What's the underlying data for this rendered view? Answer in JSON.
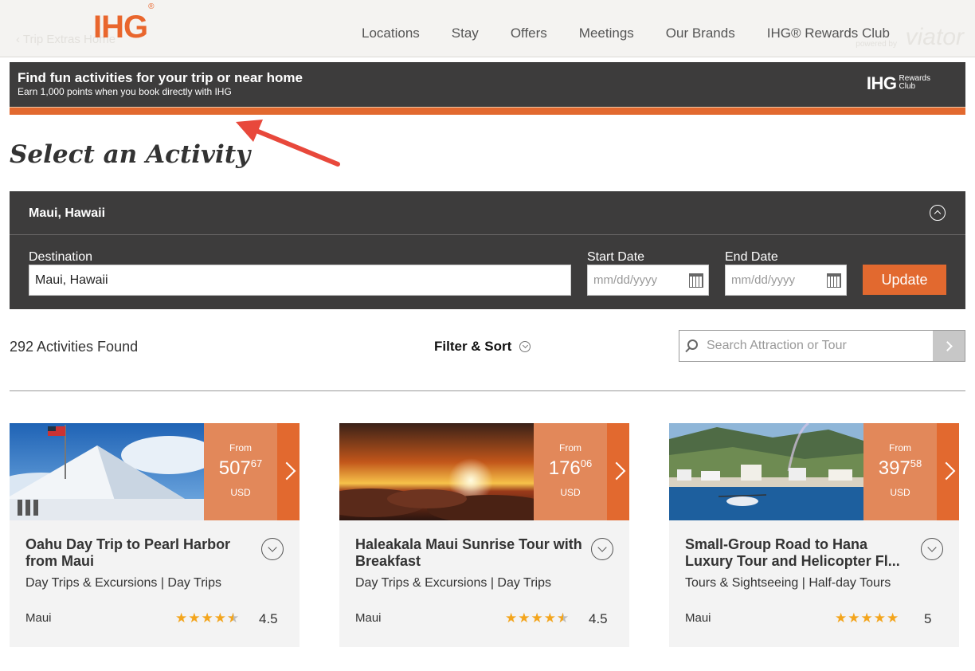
{
  "nav": {
    "logo": "IHG",
    "logo_mark": "®",
    "back_link": "Trip Extras Home",
    "powered_by": "powered by",
    "partner": "viator",
    "links": [
      "Locations",
      "Stay",
      "Offers",
      "Meetings",
      "Our Brands",
      "IHG® Rewards Club"
    ]
  },
  "banner": {
    "title": "Find fun activities for your trip or near home",
    "subtitle": "Earn 1,000 points when you book directly with IHG",
    "logo": "IHG",
    "logo_sub1": "Rewards",
    "logo_sub2": "Club",
    "stripe_color": "#e2692f"
  },
  "page": {
    "title": "Select an Activity"
  },
  "search_panel": {
    "heading": "Maui, Hawaii",
    "destination_label": "Destination",
    "destination_value": "Maui, Hawaii",
    "start_label": "Start Date",
    "start_placeholder": "mm/dd/yyyy",
    "end_label": "End Date",
    "end_placeholder": "mm/dd/yyyy",
    "update_label": "Update"
  },
  "results": {
    "count_text": "292 Activities Found",
    "filter_label": "Filter & Sort",
    "search_placeholder": "Search Attraction or Tour"
  },
  "cards": [
    {
      "from": "From",
      "price_main": "507",
      "price_cents": "67",
      "currency": "USD",
      "title": "Oahu Day Trip to Pearl Harbor from Maui",
      "category": "Day Trips & Excursions | Day Trips",
      "location": "Maui",
      "rating": "4.5"
    },
    {
      "from": "From",
      "price_main": "176",
      "price_cents": "06",
      "currency": "USD",
      "title": "Haleakala Maui Sunrise Tour with Breakfast",
      "category": "Day Trips & Excursions | Day Trips",
      "location": "Maui",
      "rating": "4.5"
    },
    {
      "from": "From",
      "price_main": "397",
      "price_cents": "58",
      "currency": "USD",
      "title": "Small-Group Road to Hana Luxury Tour and Helicopter Fl...",
      "category": "Tours & Sightseeing | Half-day Tours",
      "location": "Maui",
      "rating": "5"
    }
  ]
}
